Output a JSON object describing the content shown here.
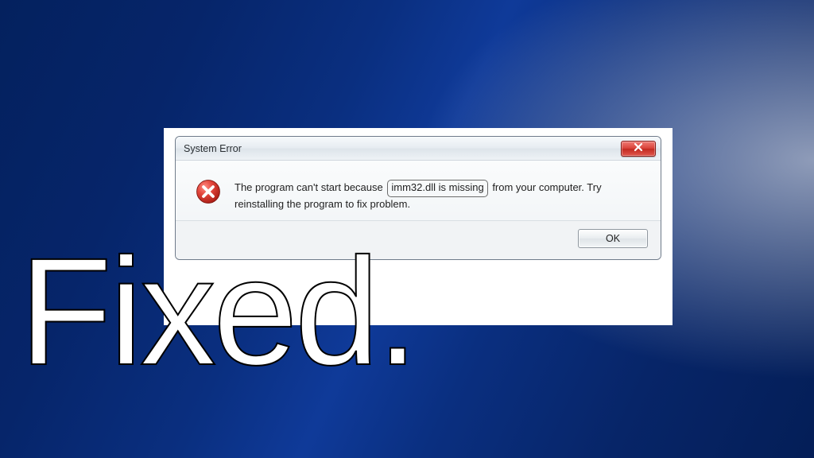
{
  "dialog": {
    "title": "System Error",
    "message_prefix": "The program can't start because",
    "message_highlight": "imm32.dll is missing",
    "message_suffix": "from your computer. Try reinstalling the program to fix problem.",
    "ok_label": "OK"
  },
  "overlay": {
    "text": "Fixed."
  },
  "colors": {
    "close_button": "#d9433a",
    "error_icon": "#d23a31"
  }
}
